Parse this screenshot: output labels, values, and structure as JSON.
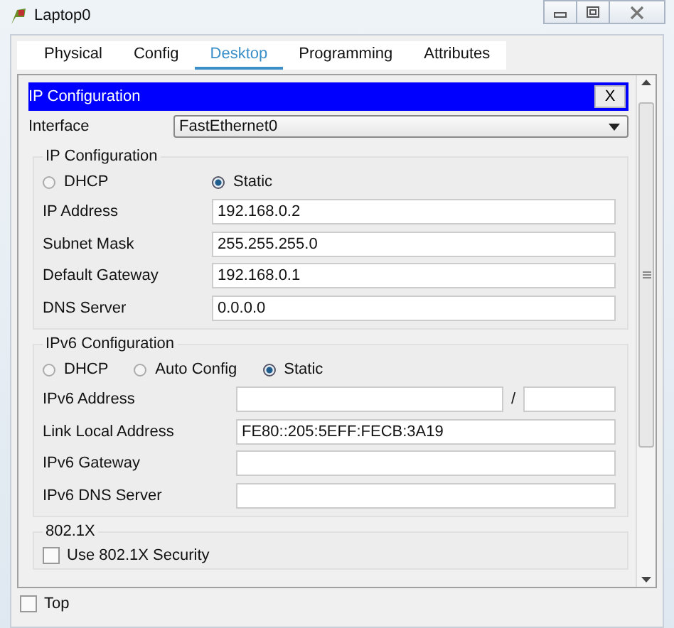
{
  "window": {
    "title": "Laptop0"
  },
  "tabs": [
    {
      "label": "Physical",
      "selected": false
    },
    {
      "label": "Config",
      "selected": false
    },
    {
      "label": "Desktop",
      "selected": true
    },
    {
      "label": "Programming",
      "selected": false
    },
    {
      "label": "Attributes",
      "selected": false
    }
  ],
  "panel": {
    "title": "IP Configuration",
    "close": "X"
  },
  "interface": {
    "label": "Interface",
    "value": "FastEthernet0"
  },
  "sections": [
    {
      "title": "IP Configuration",
      "modes": [
        {
          "label": "DHCP",
          "selected": false
        },
        {
          "label": "Static",
          "selected": true
        }
      ],
      "fields": [
        {
          "label": "IP Address",
          "kind": "text",
          "value": "192.168.0.2"
        },
        {
          "label": "Subnet Mask",
          "kind": "text",
          "value": "255.255.255.0"
        },
        {
          "label": "Default Gateway",
          "kind": "text",
          "value": "192.168.0.1"
        },
        {
          "label": "DNS Server",
          "kind": "text",
          "value": "0.0.0.0"
        }
      ]
    },
    {
      "title": "IPv6 Configuration",
      "modes": [
        {
          "label": "DHCP",
          "selected": false
        },
        {
          "label": "Auto Config",
          "selected": false
        },
        {
          "label": "Static",
          "selected": true
        }
      ],
      "fields": [
        {
          "label": "IPv6 Address",
          "kind": "prefix",
          "separator": "/"
        },
        {
          "label": "Link Local Address",
          "kind": "text",
          "value": "FE80::205:5EFF:FECB:3A19"
        },
        {
          "label": "IPv6 Gateway",
          "kind": "text"
        },
        {
          "label": "IPv6 DNS Server",
          "kind": "text"
        }
      ]
    }
  ],
  "security": {
    "title": "802.1X",
    "option": {
      "label": "Use 802.1X Security",
      "checked": false
    }
  },
  "footer": {
    "label": "Top",
    "checked": false
  }
}
